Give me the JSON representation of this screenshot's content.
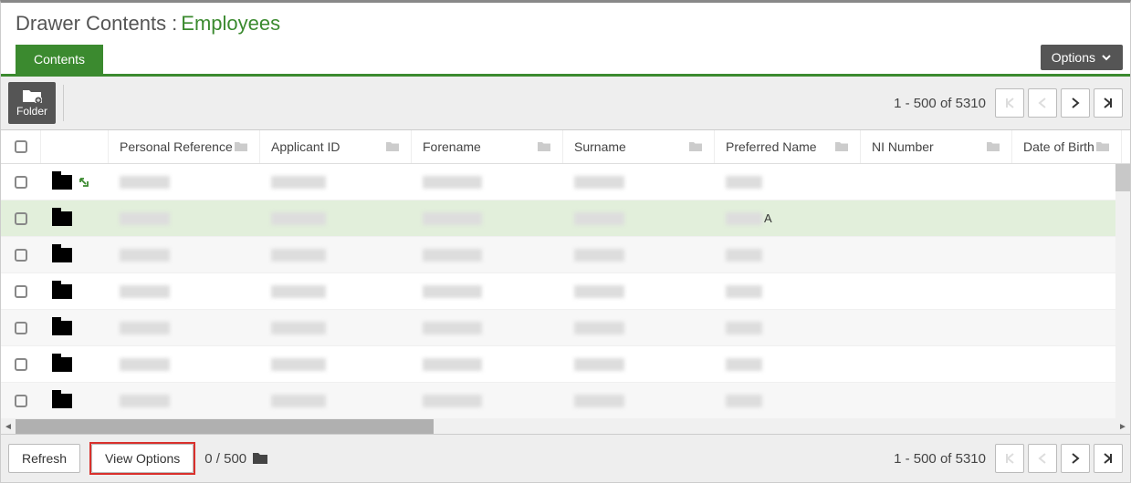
{
  "header": {
    "label": "Drawer Contents :",
    "value": "Employees"
  },
  "tabs": {
    "contents": "Contents"
  },
  "options_button": "Options",
  "toolbar": {
    "folder": "Folder"
  },
  "pagination": {
    "range": "1 - 500 of 5310"
  },
  "columns": {
    "personal_reference": "Personal Reference",
    "applicant_id": "Applicant ID",
    "forename": "Forename",
    "surname": "Surname",
    "preferred_name": "Preferred Name",
    "ni_number": "NI Number",
    "date_of_birth": "Date of Birth"
  },
  "rows": [
    {
      "highlight": false,
      "ext": true,
      "suffix": ""
    },
    {
      "highlight": true,
      "ext": false,
      "suffix": "A"
    },
    {
      "highlight": false,
      "ext": false,
      "suffix": ""
    },
    {
      "highlight": false,
      "ext": false,
      "suffix": ""
    },
    {
      "highlight": false,
      "ext": false,
      "suffix": ""
    },
    {
      "highlight": false,
      "ext": false,
      "suffix": ""
    },
    {
      "highlight": false,
      "ext": false,
      "suffix": ""
    }
  ],
  "footer": {
    "refresh": "Refresh",
    "view_options": "View Options",
    "selection": "0 / 500",
    "range": "1 - 500 of 5310"
  }
}
